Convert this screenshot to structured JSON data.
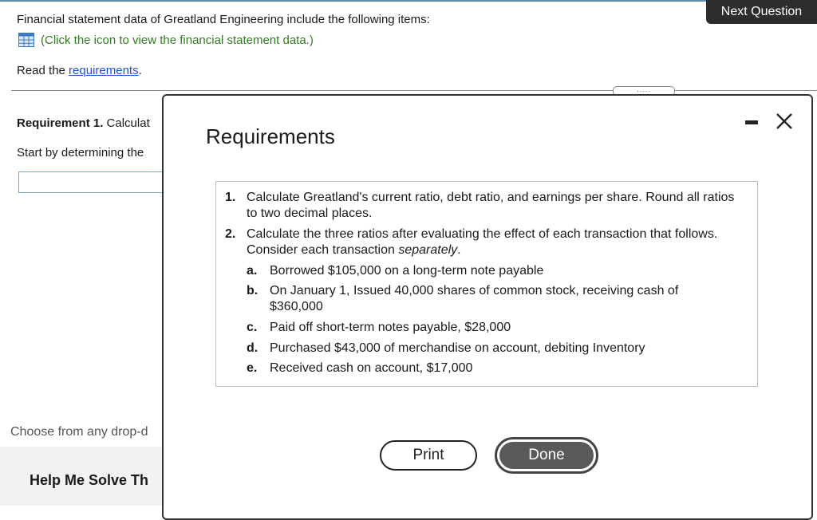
{
  "header": {
    "next_question": "Next Question"
  },
  "question": {
    "intro": "Financial statement data of Greatland Engineering include the following items:",
    "data_link": "(Click the icon to view the financial statement data.)",
    "read_prefix": "Read the ",
    "requirements_link": "requirements",
    "read_suffix": ".",
    "req1_label": "Requirement 1.",
    "req1_text": " Calculat",
    "start_text": "Start by determining the",
    "choose_text": "Choose from any drop-d",
    "help_text": "Help Me Solve Th",
    "handle_dots": "....."
  },
  "modal": {
    "title": "Requirements",
    "items": [
      {
        "num": "1.",
        "text": "Calculate Greatland's current ratio, debt ratio, and earnings per share. Round all ratios to two decimal places."
      },
      {
        "num": "2.",
        "text_main": "Calculate the three ratios after evaluating the effect of each transaction that follows. Consider each transaction ",
        "text_em": "separately",
        "text_end": "."
      }
    ],
    "subitems": [
      {
        "num": "a.",
        "text": "Borrowed $105,000 on a long-term note payable"
      },
      {
        "num": "b.",
        "text": "On January 1, Issued 40,000 shares of common stock, receiving cash of $360,000"
      },
      {
        "num": "c.",
        "text": "Paid off short-term notes payable, $28,000"
      },
      {
        "num": "d.",
        "text": "Purchased $43,000 of merchandise on account, debiting Inventory"
      },
      {
        "num": "e.",
        "text": "Received cash on account, $17,000"
      }
    ],
    "print_label": "Print",
    "done_label": "Done"
  }
}
